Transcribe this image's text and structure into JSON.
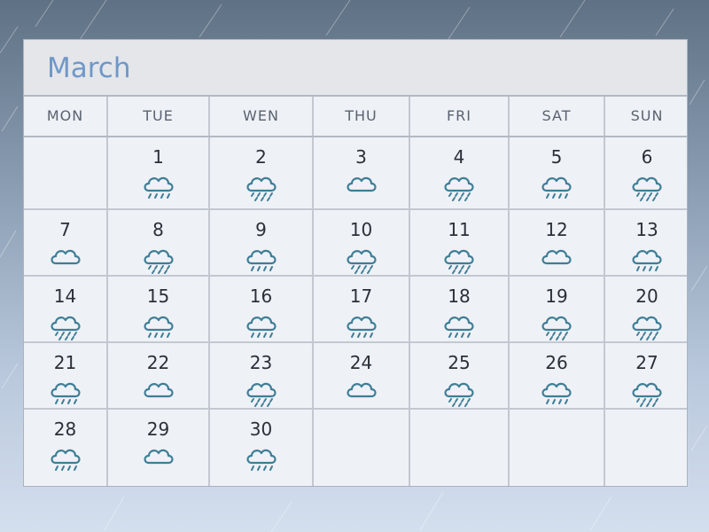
{
  "calendar": {
    "month": "March",
    "weekdays": [
      "MON",
      "TUE",
      "WEN",
      "THU",
      "FRI",
      "SAT",
      "SUN"
    ],
    "days": [
      {
        "day": "1",
        "weather": "light-rain-icon"
      },
      {
        "day": "2",
        "weather": "heavy-rain-icon"
      },
      {
        "day": "3",
        "weather": "cloud-icon"
      },
      {
        "day": "4",
        "weather": "heavy-rain-icon"
      },
      {
        "day": "5",
        "weather": "light-rain-icon"
      },
      {
        "day": "6",
        "weather": "heavy-rain-icon"
      },
      {
        "day": "7",
        "weather": "cloud-icon"
      },
      {
        "day": "8",
        "weather": "heavy-rain-icon"
      },
      {
        "day": "9",
        "weather": "light-rain-icon"
      },
      {
        "day": "10",
        "weather": "heavy-rain-icon"
      },
      {
        "day": "11",
        "weather": "heavy-rain-icon"
      },
      {
        "day": "12",
        "weather": "cloud-icon"
      },
      {
        "day": "13",
        "weather": "light-rain-icon"
      },
      {
        "day": "14",
        "weather": "heavy-rain-icon"
      },
      {
        "day": "15",
        "weather": "light-rain-icon"
      },
      {
        "day": "16",
        "weather": "light-rain-icon"
      },
      {
        "day": "17",
        "weather": "light-rain-icon"
      },
      {
        "day": "18",
        "weather": "light-rain-icon"
      },
      {
        "day": "19",
        "weather": "heavy-rain-icon"
      },
      {
        "day": "20",
        "weather": "heavy-rain-icon"
      },
      {
        "day": "21",
        "weather": "light-rain-icon"
      },
      {
        "day": "22",
        "weather": "cloud-icon"
      },
      {
        "day": "23",
        "weather": "heavy-rain-icon"
      },
      {
        "day": "24",
        "weather": "cloud-icon"
      },
      {
        "day": "25",
        "weather": "heavy-rain-icon"
      },
      {
        "day": "26",
        "weather": "light-rain-icon"
      },
      {
        "day": "27",
        "weather": "heavy-rain-icon"
      },
      {
        "day": "28",
        "weather": "light-rain-icon"
      },
      {
        "day": "29",
        "weather": "cloud-icon"
      },
      {
        "day": "30",
        "weather": "light-rain-icon"
      }
    ],
    "first_weekday_index": 1,
    "colors": {
      "icon": "#3f7e96",
      "title": "#6f97c8"
    }
  }
}
